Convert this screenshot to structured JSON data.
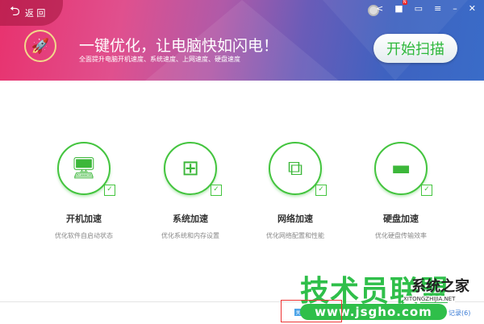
{
  "header": {
    "back_label": "返 回",
    "title": "一键优化，让电脑快如闪电！",
    "subtitle": "全面提升电脑开机速度、系统速度、上网速度、硬盘速度",
    "scan_button": "开始扫描"
  },
  "window_controls": {
    "badge": "N"
  },
  "items": [
    {
      "name": "开机加速",
      "desc": "优化软件自启动状态",
      "icon": "monitor-boost-icon"
    },
    {
      "name": "系统加速",
      "desc": "优化系统和内存设置",
      "icon": "windows-up-icon"
    },
    {
      "name": "网络加速",
      "desc": "优化网络配置和性能",
      "icon": "network-icon"
    },
    {
      "name": "硬盘加速",
      "desc": "优化硬盘传输效率",
      "icon": "disk-icon"
    }
  ],
  "footer": {
    "records_link": "记录(6)",
    "badge": "关"
  },
  "watermark": {
    "brand": "技术员联盟",
    "site": "www.jsgho.com",
    "brand2": "系统之家",
    "site2": "XITONGZHIJIA.NET"
  }
}
